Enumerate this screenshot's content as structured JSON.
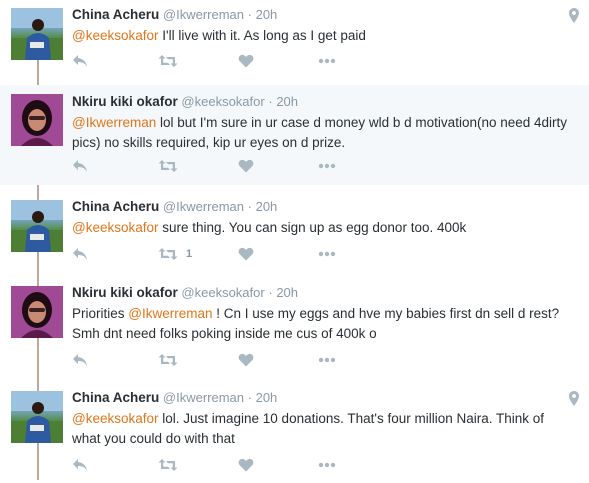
{
  "colors": {
    "mention": "#e0761a",
    "muted": "#8899a6",
    "icon": "#aab8c2",
    "thread_line": "#bfa79a",
    "alt_background": "#f5f8fa"
  },
  "tweets": [
    {
      "fullname": "China Acheru",
      "username": "@Ikwerreman",
      "separator": "·",
      "time": "20h",
      "mention": "@keeksokafor",
      "text": " I'll live with it. As long as I get paid",
      "retweet_count": "",
      "has_geo": true,
      "avatar_icon": "avatar-photo"
    },
    {
      "fullname": "Nkiru kiki okafor",
      "username": "@keeksokafor",
      "separator": "·",
      "time": "20h",
      "mention": "@Ikwerreman",
      "text": " lol but I'm sure in ur case d money wld b d motivation(no need 4dirty pics) no skills required, kip ur eyes on d prize.",
      "retweet_count": "",
      "has_geo": false,
      "avatar_icon": "avatar-photo"
    },
    {
      "fullname": "China Acheru",
      "username": "@Ikwerreman",
      "separator": "·",
      "time": "20h",
      "mention": "@keeksokafor",
      "text": " sure thing. You can sign up as egg donor too. 400k",
      "retweet_count": "1",
      "has_geo": false,
      "avatar_icon": "avatar-photo"
    },
    {
      "fullname": "Nkiru kiki okafor",
      "username": "@keeksokafor",
      "separator": "·",
      "time": "20h",
      "prefix": "Priorities ",
      "mention": "@Ikwerreman",
      "text": " ! Cn I use my eggs and hve my babies first dn sell d rest? Smh dnt need folks poking inside me cus of 400k o",
      "retweet_count": "",
      "has_geo": false,
      "avatar_icon": "avatar-photo"
    },
    {
      "fullname": "China Acheru",
      "username": "@Ikwerreman",
      "separator": "·",
      "time": "20h",
      "mention": "@keeksokafor",
      "text": " lol. Just imagine 10 donations. That's four million Naira. Think of what you could do with that",
      "retweet_count": "",
      "has_geo": true,
      "avatar_icon": "avatar-photo"
    }
  ],
  "icons": {
    "reply": "reply-icon",
    "retweet": "retweet-icon",
    "like": "heart-icon",
    "more": "more-icon",
    "geo": "location-pin-icon"
  }
}
